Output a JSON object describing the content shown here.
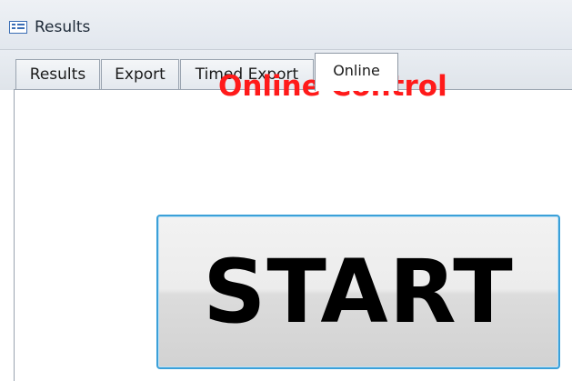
{
  "window": {
    "title": "Results",
    "icon": "form-icon"
  },
  "tabs": [
    {
      "label": "Results",
      "active": false
    },
    {
      "label": "Export",
      "active": false
    },
    {
      "label": "Timed Export",
      "active": false
    },
    {
      "label": "Online",
      "active": true
    }
  ],
  "online": {
    "heading": "Online Control",
    "start_label": "START",
    "heading_color": "#ff1a1a",
    "button_border_color": "#3ba0d8"
  }
}
